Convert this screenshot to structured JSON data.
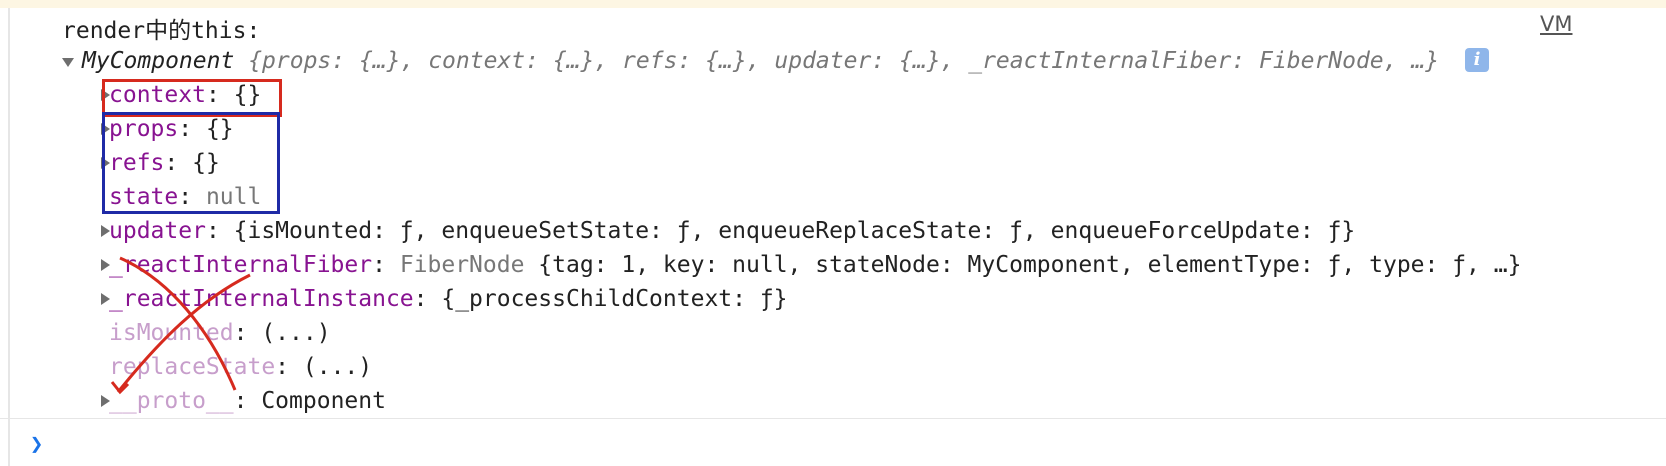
{
  "console": {
    "log_label": "render中的this:",
    "source_link": "VM",
    "summary": {
      "class_name": "MyComponent",
      "preview": "{props: {…}, context: {…}, refs: {…}, updater: {…}, _reactInternalFiber: FiberNode, …}",
      "info_icon": "i"
    },
    "properties": [
      {
        "key": "context",
        "value": "{}",
        "expandable": true
      },
      {
        "key": "props",
        "value": "{}",
        "expandable": true
      },
      {
        "key": "refs",
        "value": "{}",
        "expandable": true
      },
      {
        "key": "state",
        "value": "null",
        "expandable": false
      },
      {
        "key": "updater",
        "value": "{isMounted: ƒ, enqueueSetState: ƒ, enqueueReplaceState: ƒ, enqueueForceUpdate: ƒ}",
        "expandable": true
      },
      {
        "key": "_reactInternalFiber",
        "value_type": "FiberNode",
        "value": "{tag: 1, key: null, stateNode: MyComponent, elementType: ƒ, type: ƒ, …}",
        "expandable": true
      },
      {
        "key": "_reactInternalInstance",
        "value": "{_processChildContext: ƒ}",
        "expandable": true
      },
      {
        "key": "isMounted",
        "value": "(...)",
        "expandable": false
      },
      {
        "key": "replaceState",
        "value": "(...)",
        "expandable": false
      },
      {
        "key": "__proto__",
        "value": "Component",
        "expandable": true
      }
    ]
  },
  "annotations": {
    "red_box_color": "#d62a1e",
    "blue_box_color": "#1f2aa6",
    "cross_color": "#d62a1e"
  },
  "icons": [
    "expand-triangle-icon",
    "collapse-triangle-icon",
    "info-icon",
    "prompt-caret-icon"
  ]
}
